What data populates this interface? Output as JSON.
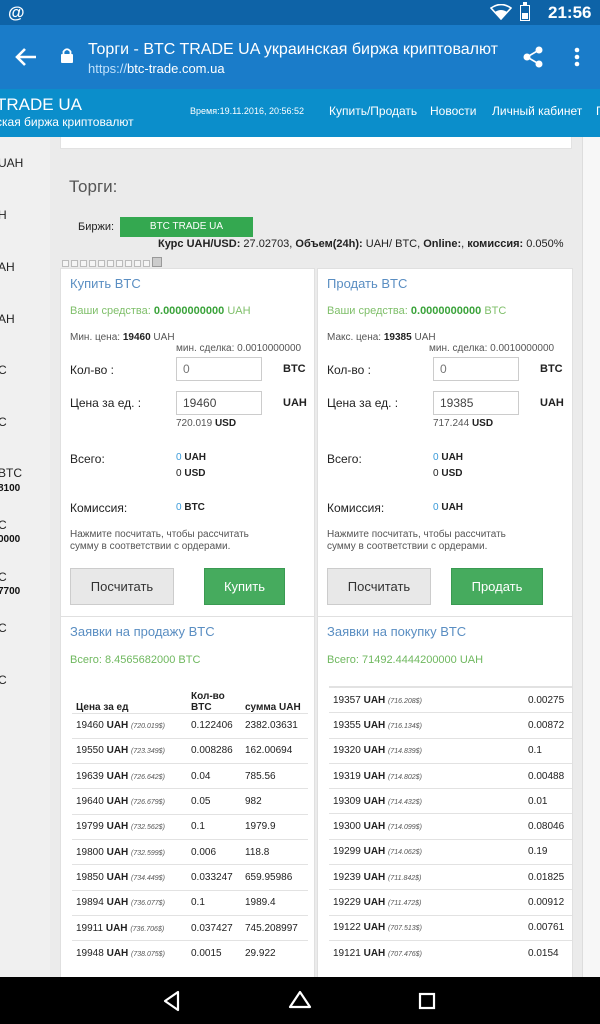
{
  "status_bar": {
    "notification": "@",
    "time": "21:56"
  },
  "browser": {
    "title": "Торги - BTC TRADE UA украинская биржа криптовалют",
    "url_scheme": "https://",
    "url_host": "btc-trade.com.ua"
  },
  "site_nav": {
    "logo_line1": "TRADE UA",
    "logo_line2": "ская биржа криптовалют",
    "time": "Время:19.11.2016, 20:56:52",
    "links": [
      "Купить/Продать",
      "Новости",
      "Личный кабинет",
      "П"
    ]
  },
  "sidebar": {
    "items": [
      "UAH",
      "H",
      "AH",
      "AH",
      "C",
      "C",
      "BTC",
      "C",
      "C",
      "C",
      "C"
    ],
    "subs": [
      "8100",
      "0000",
      "7700"
    ]
  },
  "trading": {
    "heading": "Торги:",
    "exchanges_label": "Биржи:",
    "exchange_button": "BTC TRADE UA",
    "rate_label": "Курс UAH/USD:",
    "rate_value": "27.02703,",
    "volume_label": "Объем(24h):",
    "volume_value": "UAH/ BTC,",
    "online_label": "Online:",
    "online_value": ",",
    "commission_label": "комиссия:",
    "commission_value": "0.050%"
  },
  "buy": {
    "title": "Купить BTC",
    "funds_label": "Ваши средства:",
    "funds_value": "0.0000000000",
    "funds_unit": "UAH",
    "price_label": "Мин. цена:",
    "price_value": "19460",
    "price_unit": "UAH",
    "min_deal": "мин. сделка: 0.0010000000",
    "qty_label": "Кол-во :",
    "qty_placeholder": "0",
    "qty_unit": "BTC",
    "unit_price_label": "Цена за ед. :",
    "unit_price_value": "19460",
    "unit_price_unit": "UAH",
    "unit_price_usd": "720.019",
    "usd": "USD",
    "total_label": "Всего:",
    "total_uah": "0",
    "total_uah_unit": "UAH",
    "total_usd": "0",
    "total_usd_unit": "USD",
    "fee_label": "Комиссия:",
    "fee_value": "0",
    "fee_unit": "BTC",
    "hint": "Нажмите посчитать, чтобы рассчитать сумму в соответствии с ордерами.",
    "calc_button": "Посчитать",
    "action_button": "Купить"
  },
  "sell": {
    "title": "Продать BTC",
    "funds_label": "Ваши средства:",
    "funds_value": "0.0000000000",
    "funds_unit": "BTC",
    "price_label": "Макс. цена:",
    "price_value": "19385",
    "price_unit": "UAH",
    "min_deal": "мин. сделка: 0.0010000000",
    "qty_label": "Кол-во :",
    "qty_placeholder": "0",
    "qty_unit": "BTC",
    "unit_price_label": "Цена за ед. :",
    "unit_price_value": "19385",
    "unit_price_unit": "UAH",
    "unit_price_usd": "717.244",
    "usd": "USD",
    "total_label": "Всего:",
    "total_uah": "0",
    "total_uah_unit": "UAH",
    "total_usd": "0",
    "total_usd_unit": "USD",
    "fee_label": "Комиссия:",
    "fee_value": "0",
    "fee_unit": "UAH",
    "hint": "Нажмите посчитать, чтобы рассчитать сумму в соответствии с ордерами.",
    "calc_button": "Посчитать",
    "action_button": "Продать"
  },
  "sell_orders": {
    "title": "Заявки на продажу BTC",
    "total_label": "Всего:",
    "total_value": "8.4565682000",
    "total_unit": "BTC",
    "headers": [
      "Цена за ед",
      "Кол-во BTC",
      "сумма UAH"
    ],
    "rows": [
      {
        "price": "19460",
        "unit": "UAH",
        "usd": "(720.019$)",
        "qty": "0.122406",
        "sum": "2382.03631"
      },
      {
        "price": "19550",
        "unit": "UAH",
        "usd": "(723.349$)",
        "qty": "0.008286",
        "sum": "162.00694"
      },
      {
        "price": "19639",
        "unit": "UAH",
        "usd": "(726.642$)",
        "qty": "0.04",
        "sum": "785.56"
      },
      {
        "price": "19640",
        "unit": "UAH",
        "usd": "(726.679$)",
        "qty": "0.05",
        "sum": "982"
      },
      {
        "price": "19799",
        "unit": "UAH",
        "usd": "(732.562$)",
        "qty": "0.1",
        "sum": "1979.9"
      },
      {
        "price": "19800",
        "unit": "UAH",
        "usd": "(732.599$)",
        "qty": "0.006",
        "sum": "118.8"
      },
      {
        "price": "19850",
        "unit": "UAH",
        "usd": "(734.449$)",
        "qty": "0.033247",
        "sum": "659.95986"
      },
      {
        "price": "19894",
        "unit": "UAH",
        "usd": "(736.077$)",
        "qty": "0.1",
        "sum": "1989.4"
      },
      {
        "price": "19911",
        "unit": "UAH",
        "usd": "(736.706$)",
        "qty": "0.037427",
        "sum": "745.208997"
      },
      {
        "price": "19948",
        "unit": "UAH",
        "usd": "(738.075$)",
        "qty": "0.0015",
        "sum": "29.922"
      }
    ]
  },
  "buy_orders": {
    "title": "Заявки на покупку BTC",
    "total_label": "Всего:",
    "total_value": "71492.4444200000",
    "total_unit": "UAH",
    "rows": [
      {
        "price": "19357",
        "unit": "UAH",
        "usd": "(716.208$)",
        "qty": "0.00275"
      },
      {
        "price": "19355",
        "unit": "UAH",
        "usd": "(716.134$)",
        "qty": "0.00872"
      },
      {
        "price": "19320",
        "unit": "UAH",
        "usd": "(714.839$)",
        "qty": "0.1"
      },
      {
        "price": "19319",
        "unit": "UAH",
        "usd": "(714.802$)",
        "qty": "0.00488"
      },
      {
        "price": "19309",
        "unit": "UAH",
        "usd": "(714.432$)",
        "qty": "0.01"
      },
      {
        "price": "19300",
        "unit": "UAH",
        "usd": "(714.099$)",
        "qty": "0.08046"
      },
      {
        "price": "19299",
        "unit": "UAH",
        "usd": "(714.062$)",
        "qty": "0.19"
      },
      {
        "price": "19239",
        "unit": "UAH",
        "usd": "(711.842$)",
        "qty": "0.01825"
      },
      {
        "price": "19229",
        "unit": "UAH",
        "usd": "(711.472$)",
        "qty": "0.00912"
      },
      {
        "price": "19122",
        "unit": "UAH",
        "usd": "(707.513$)",
        "qty": "0.00761"
      },
      {
        "price": "19121",
        "unit": "UAH",
        "usd": "(707.476$)",
        "qty": "0.0154"
      }
    ]
  }
}
